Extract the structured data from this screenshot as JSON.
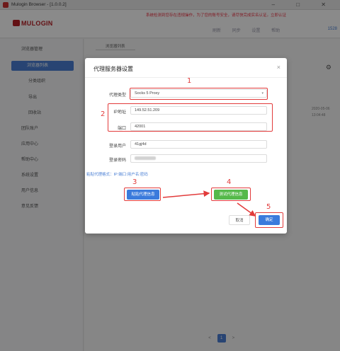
{
  "window": {
    "title": "Mulogin Browser - [1.0.0.2]",
    "controls": "– □ ✕"
  },
  "header": {
    "logo": "MULOGIN",
    "notice": "系统检测到您存在违规操作，为了您的账号安全，请尽快完成实名认证。立即认证",
    "tools": [
      "刷新",
      "同步",
      "设置",
      "帮助"
    ],
    "user_id": "1528"
  },
  "sidebar": {
    "items": [
      {
        "label": "浏览器管理",
        "active": false
      },
      {
        "label": "浏览器列表",
        "active": true
      },
      {
        "label": "分类组织",
        "active": false
      },
      {
        "label": "导出",
        "active": false
      },
      {
        "label": "回收站",
        "active": false
      },
      {
        "label": "团队账户",
        "active": false
      },
      {
        "label": "应用中心",
        "active": false
      },
      {
        "label": "帮助中心",
        "active": false
      },
      {
        "label": "系统设置",
        "active": false
      },
      {
        "label": "用户信息",
        "active": false
      },
      {
        "label": "意见反馈",
        "active": false
      }
    ]
  },
  "main": {
    "tab": "浏览器列表",
    "side_dates": [
      "2020-05-06",
      "13:04:48"
    ],
    "pagination": {
      "prev": "<",
      "current": "1",
      "next": ">"
    }
  },
  "dialog": {
    "title": "代理服务器设置",
    "close": "×",
    "fields": {
      "proxy_type": {
        "label": "代理类型",
        "value": "Socks 5 Proxy"
      },
      "ip": {
        "label": "IP地址",
        "value": "149.52.51.209"
      },
      "port": {
        "label": "端口",
        "value": "42001"
      },
      "username": {
        "label": "登录用户",
        "value": "41gj4d"
      },
      "password": {
        "label": "登录密码"
      }
    },
    "hint": "粘贴代理格式：IP:端口:用户名:密码",
    "buttons": {
      "paste": "粘贴代理信息",
      "check": "测试代理信息",
      "cancel": "取消",
      "ok": "确定"
    }
  },
  "annotations": {
    "n1": "1",
    "n2": "2",
    "n3": "3",
    "n4": "4",
    "n5": "5"
  },
  "colors": {
    "accent": "#3b7bdc",
    "check": "#55b94a",
    "annotation": "#e23b3b",
    "brand": "#b82025"
  }
}
